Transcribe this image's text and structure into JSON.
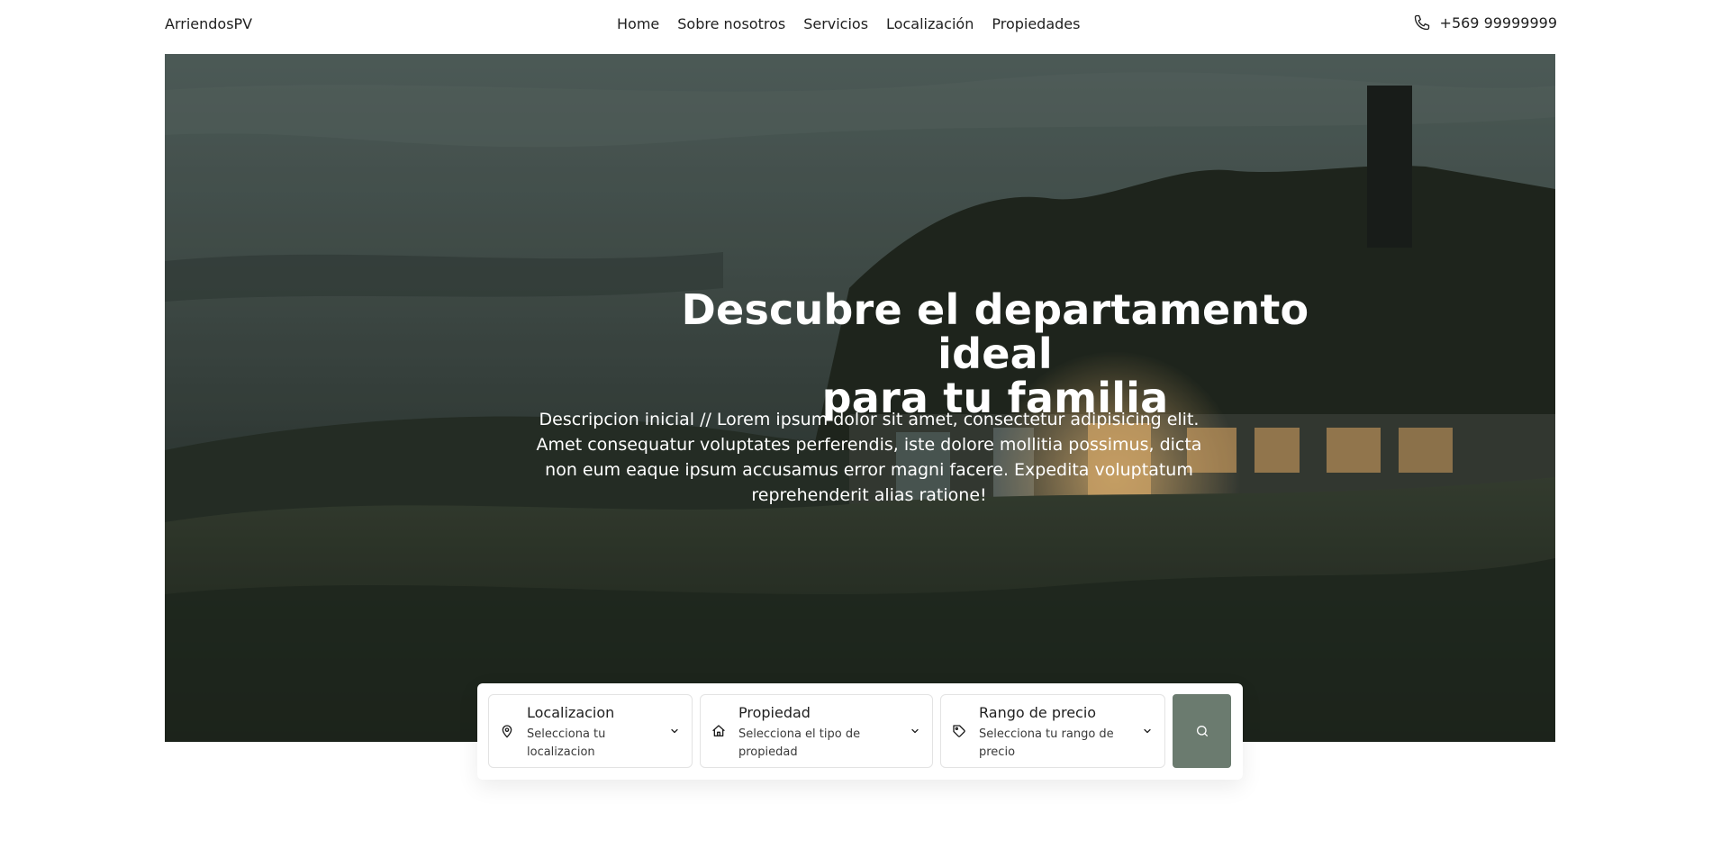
{
  "header": {
    "brand": "ArriendosPV",
    "nav": [
      {
        "label": "Home"
      },
      {
        "label": "Sobre nosotros"
      },
      {
        "label": "Servicios"
      },
      {
        "label": "Localización"
      },
      {
        "label": "Propiedades"
      }
    ],
    "phone": "+569 99999999"
  },
  "hero": {
    "title_line1": "Descubre el departamento ideal",
    "title_line2": "para tu familia",
    "description": "Descripcion inicial // Lorem ipsum dolor sit amet, consectetur adipisicing elit. Amet consequatur voluptates perferendis, iste dolore mollitia possimus, dicta non eum eaque ipsum accusamus error magni facere. Expedita voluptatum reprehenderit alias ratione!"
  },
  "search": {
    "location": {
      "label": "Localizacion",
      "hint": "Selecciona tu localizacion"
    },
    "property": {
      "label": "Propiedad",
      "hint": "Selecciona el tipo de propiedad"
    },
    "price": {
      "label": "Rango de precio",
      "hint": "Selecciona tu rango de precio"
    }
  },
  "colors": {
    "accent": "#6b7b6f",
    "text": "#1f1f1f"
  },
  "icons": {
    "phone": "phone-icon",
    "location": "map-pin-icon",
    "property": "home-icon",
    "price": "tag-icon",
    "dropdown": "chevron-down-icon",
    "search": "search-icon"
  }
}
